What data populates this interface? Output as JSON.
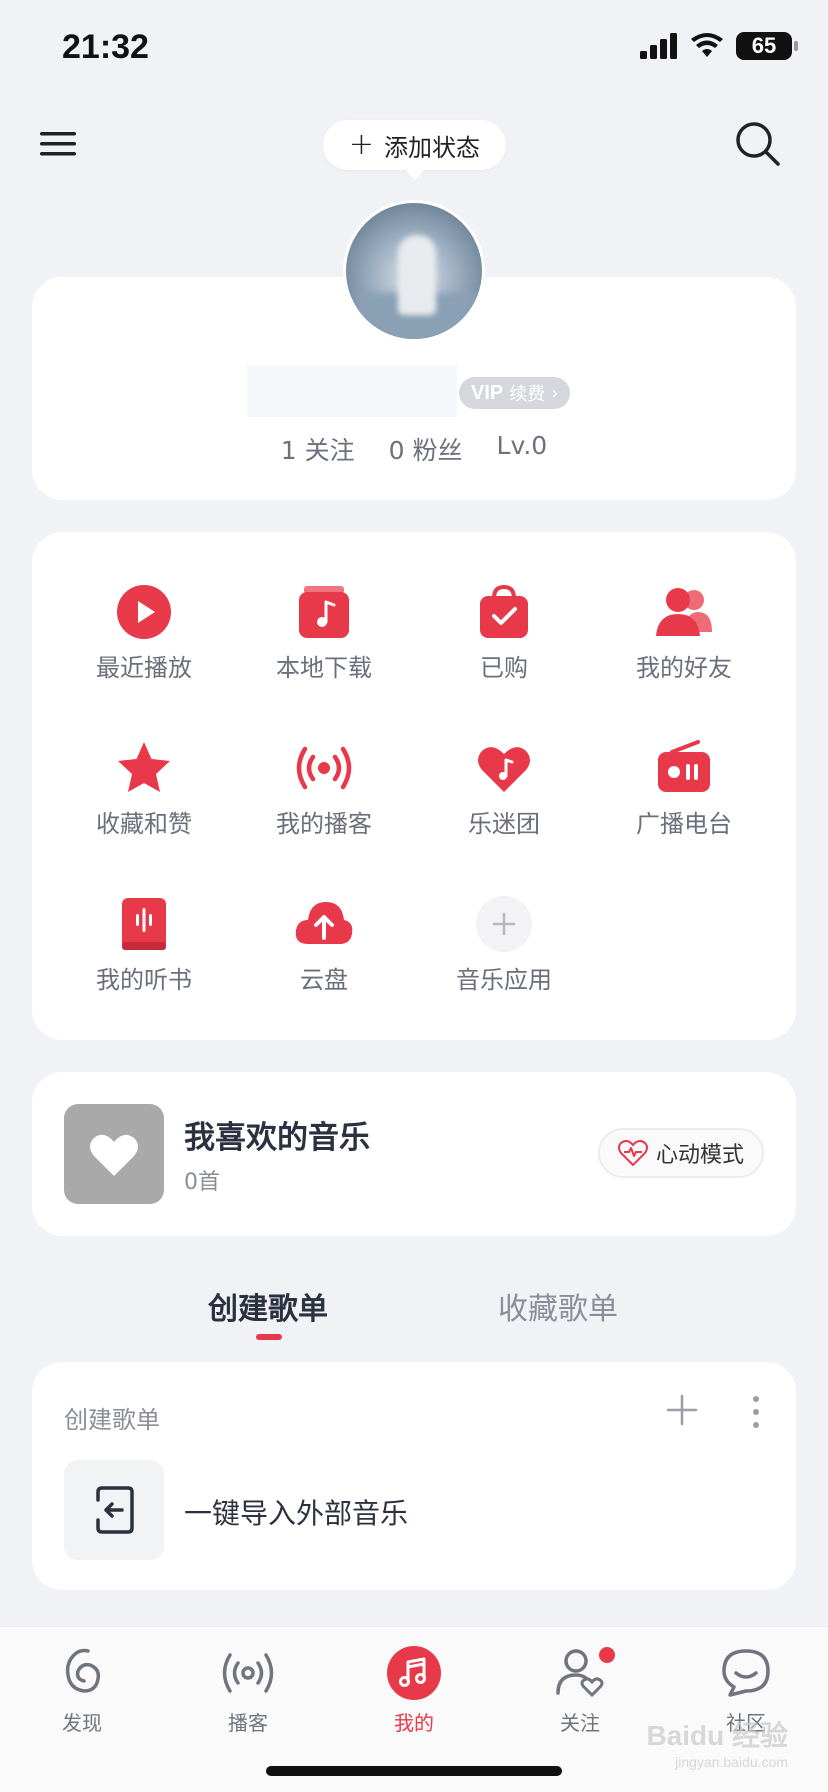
{
  "status_bar": {
    "time": "21:32",
    "battery": "65"
  },
  "header": {
    "status_button_label": "添加状态"
  },
  "profile": {
    "vip_label": "续费",
    "vip_brand": "VIP",
    "stats": {
      "following_count": "1",
      "following_label": "关注",
      "fans_count": "0",
      "fans_label": "粉丝",
      "level": "Lv.0"
    }
  },
  "grid": {
    "items": [
      {
        "label": "最近播放",
        "icon": "play-circle-icon"
      },
      {
        "label": "本地下载",
        "icon": "music-note-folder-icon"
      },
      {
        "label": "已购",
        "icon": "shopping-bag-check-icon"
      },
      {
        "label": "我的好友",
        "icon": "friends-icon"
      },
      {
        "label": "收藏和赞",
        "icon": "star-icon"
      },
      {
        "label": "我的播客",
        "icon": "broadcast-icon"
      },
      {
        "label": "乐迷团",
        "icon": "heart-music-icon"
      },
      {
        "label": "广播电台",
        "icon": "radio-icon"
      },
      {
        "label": "我的听书",
        "icon": "book-audio-icon"
      },
      {
        "label": "云盘",
        "icon": "cloud-upload-icon"
      },
      {
        "label": "音乐应用",
        "icon": "plus-circle-icon"
      }
    ]
  },
  "liked": {
    "title": "我喜欢的音乐",
    "count": "0首",
    "mode_button": "心动模式"
  },
  "tabs": {
    "created": "创建歌单",
    "collected": "收藏歌单"
  },
  "playlists": {
    "header": "创建歌单",
    "import_label": "一键导入外部音乐"
  },
  "bottom_nav": [
    {
      "label": "发现",
      "icon": "discover-icon"
    },
    {
      "label": "播客",
      "icon": "podcast-icon"
    },
    {
      "label": "我的",
      "icon": "music-note-icon"
    },
    {
      "label": "关注",
      "icon": "follow-icon"
    },
    {
      "label": "社区",
      "icon": "community-icon"
    }
  ],
  "colors": {
    "accent": "#e8394a",
    "background": "#f1f2f6",
    "card": "#ffffff"
  },
  "watermark": {
    "brand": "Baidu 经验",
    "url": "jingyan.baidu.com"
  }
}
